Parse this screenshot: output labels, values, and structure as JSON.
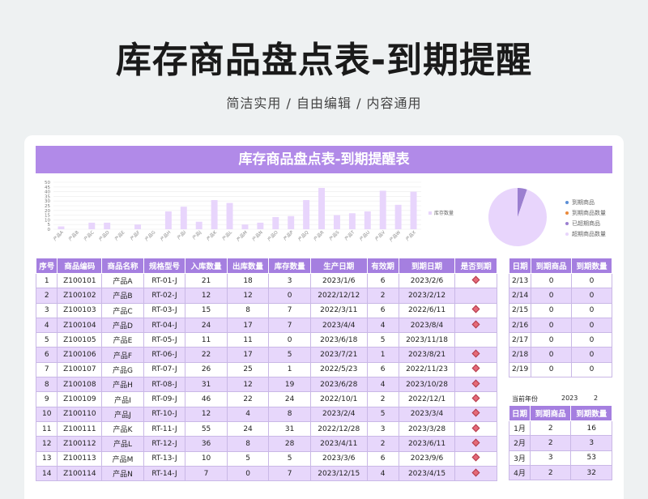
{
  "page": {
    "title": "库存商品盘点表-到期提醒",
    "subtitle": "简洁实用 / 自由编辑 / 内容通用"
  },
  "sheet": {
    "banner": "库存商品盘点表-到期提醒表"
  },
  "chart_data": [
    {
      "type": "bar",
      "categories": [
        "产品A",
        "产品B",
        "产品C",
        "产品D",
        "产品E",
        "产品F",
        "产品G",
        "产品H",
        "产品I",
        "产品J",
        "产品K",
        "产品L",
        "产品M",
        "产品N",
        "产品O",
        "产品P",
        "产品Q",
        "产品R",
        "产品S",
        "产品T",
        "产品U",
        "产品V",
        "产品W",
        "产品X"
      ],
      "series": [
        {
          "name": "库存数量",
          "values": [
            3,
            0,
            7,
            7,
            0,
            5,
            0,
            19,
            24,
            8,
            31,
            28,
            5,
            7,
            13,
            14,
            31,
            44,
            15,
            17,
            19,
            41,
            26,
            40
          ]
        }
      ],
      "yticks": [
        0,
        5,
        10,
        15,
        20,
        25,
        30,
        35,
        40,
        45,
        50
      ],
      "ylim": [
        0,
        50
      ],
      "legend": "库存数量",
      "color": "#e8d5fc"
    },
    {
      "type": "pie",
      "legend": [
        "到期商品",
        "到期商品数量",
        "已超期商品",
        "超期商品数量"
      ],
      "values": [
        0,
        0,
        1,
        18
      ],
      "colors": [
        "#5b8fd6",
        "#ea8a3b",
        "#9b7fd0",
        "#e8d5fc"
      ]
    }
  ],
  "main_table": {
    "headers": [
      "序号",
      "商品编码",
      "商品名称",
      "规格型号",
      "入库数量",
      "出库数量",
      "库存数量",
      "生产日期",
      "有效期",
      "到期日期",
      "是否到期"
    ],
    "rows": [
      [
        "1",
        "Z100101",
        "产品A",
        "RT-01-J",
        "21",
        "18",
        "3",
        "2023/1/6",
        "6",
        "2023/2/6",
        "◆"
      ],
      [
        "2",
        "Z100102",
        "产品B",
        "RT-02-J",
        "12",
        "12",
        "0",
        "2022/12/12",
        "2",
        "2023/2/12",
        ""
      ],
      [
        "3",
        "Z100103",
        "产品C",
        "RT-03-J",
        "15",
        "8",
        "7",
        "2022/3/11",
        "6",
        "2022/6/11",
        "◆"
      ],
      [
        "4",
        "Z100104",
        "产品D",
        "RT-04-J",
        "24",
        "17",
        "7",
        "2023/4/4",
        "4",
        "2023/8/4",
        "◆"
      ],
      [
        "5",
        "Z100105",
        "产品E",
        "RT-05-J",
        "11",
        "11",
        "0",
        "2023/6/18",
        "5",
        "2023/11/18",
        ""
      ],
      [
        "6",
        "Z100106",
        "产品F",
        "RT-06-J",
        "22",
        "17",
        "5",
        "2023/7/21",
        "1",
        "2023/8/21",
        "◆"
      ],
      [
        "7",
        "Z100107",
        "产品G",
        "RT-07-J",
        "26",
        "25",
        "1",
        "2022/5/23",
        "6",
        "2022/11/23",
        "◆"
      ],
      [
        "8",
        "Z100108",
        "产品H",
        "RT-08-J",
        "31",
        "12",
        "19",
        "2023/6/28",
        "4",
        "2023/10/28",
        "◆"
      ],
      [
        "9",
        "Z100109",
        "产品I",
        "RT-09-J",
        "46",
        "22",
        "24",
        "2022/10/1",
        "2",
        "2022/12/1",
        "◆"
      ],
      [
        "10",
        "Z100110",
        "产品J",
        "RT-10-J",
        "12",
        "4",
        "8",
        "2023/2/4",
        "5",
        "2023/3/4",
        "◆"
      ],
      [
        "11",
        "Z100111",
        "产品K",
        "RT-11-J",
        "55",
        "24",
        "31",
        "2022/12/28",
        "3",
        "2023/3/28",
        "◆"
      ],
      [
        "12",
        "Z100112",
        "产品L",
        "RT-12-J",
        "36",
        "8",
        "28",
        "2023/4/11",
        "2",
        "2023/6/11",
        "◆"
      ],
      [
        "13",
        "Z100113",
        "产品M",
        "RT-13-J",
        "10",
        "5",
        "5",
        "2023/3/6",
        "6",
        "2023/9/6",
        "◆"
      ],
      [
        "14",
        "Z100114",
        "产品N",
        "RT-14-J",
        "7",
        "0",
        "7",
        "2023/12/15",
        "4",
        "2023/4/15",
        "◆"
      ]
    ]
  },
  "side_table": {
    "headers": [
      "日期",
      "到期商品",
      "到期数量"
    ],
    "rows": [
      [
        "2/13",
        "0",
        "0"
      ],
      [
        "2/14",
        "0",
        "0"
      ],
      [
        "2/15",
        "0",
        "0"
      ],
      [
        "2/16",
        "0",
        "0"
      ],
      [
        "2/17",
        "0",
        "0"
      ],
      [
        "2/18",
        "0",
        "0"
      ],
      [
        "2/19",
        "0",
        "0"
      ]
    ]
  },
  "year_info": {
    "label": "当前年份",
    "year": "2023",
    "value": "2"
  },
  "month_table": {
    "headers": [
      "日期",
      "到期商品",
      "到期数量"
    ],
    "rows": [
      [
        "1月",
        "2",
        "16"
      ],
      [
        "2月",
        "2",
        "3"
      ],
      [
        "3月",
        "3",
        "53"
      ],
      [
        "4月",
        "2",
        "32"
      ]
    ]
  }
}
